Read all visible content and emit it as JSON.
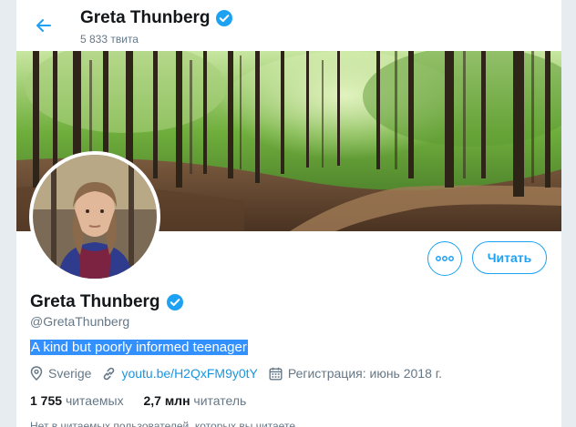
{
  "header": {
    "name": "Greta Thunberg",
    "tweet_count": "5 833 твита"
  },
  "actions": {
    "follow_label": "Читать",
    "more_icon": "more-icon"
  },
  "profile": {
    "name": "Greta Thunberg",
    "handle": "@GretaThunberg",
    "bio": "A kind but poorly informed teenager",
    "location": "Sverige",
    "link": "youtu.be/H2QxFM9y0tY",
    "joined": "Регистрация: июнь 2018 г.",
    "following_count": "1 755",
    "following_label": "читаемых",
    "followers_count": "2,7 млн",
    "followers_label": "читатель",
    "cutoff_text": "Нет в читаемых пользователей, которых вы читаете"
  },
  "colors": {
    "accent": "#1da1f2",
    "verified": "#1da1f2",
    "selection": "#3390ff"
  }
}
